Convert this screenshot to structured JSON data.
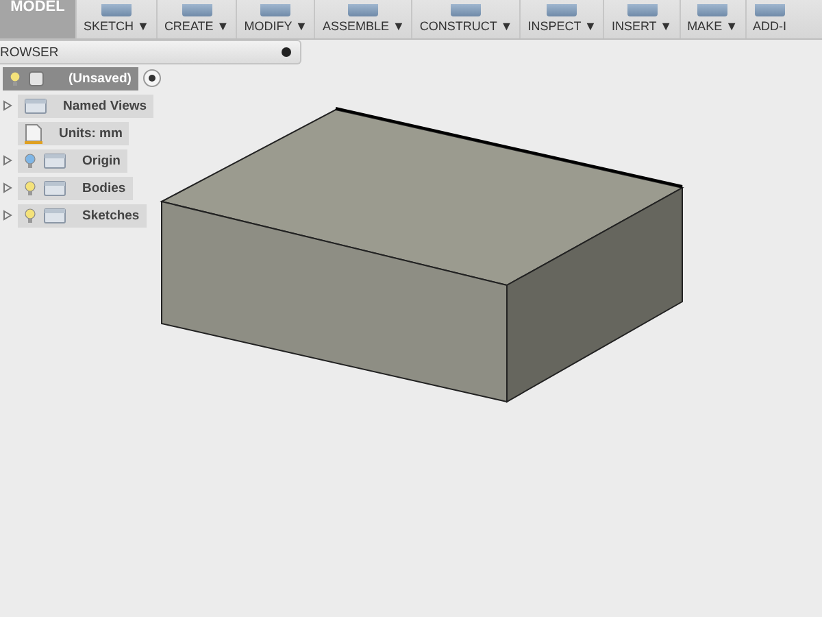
{
  "toolbar": {
    "workspace": "MODEL",
    "menus": [
      {
        "label": "SKETCH",
        "arrow": "▼"
      },
      {
        "label": "CREATE",
        "arrow": "▼"
      },
      {
        "label": "MODIFY",
        "arrow": "▼"
      },
      {
        "label": "ASSEMBLE",
        "arrow": "▼"
      },
      {
        "label": "CONSTRUCT",
        "arrow": "▼"
      },
      {
        "label": "INSPECT",
        "arrow": "▼"
      },
      {
        "label": "INSERT",
        "arrow": "▼"
      },
      {
        "label": "MAKE",
        "arrow": "▼"
      },
      {
        "label": "ADD-I"
      }
    ]
  },
  "browser": {
    "title": "ROWSER",
    "root": {
      "label": "(Unsaved)",
      "lit": true
    },
    "items": [
      {
        "label": "Named Views",
        "kind": "folder",
        "expanded": false
      },
      {
        "label": "Units: mm",
        "kind": "units"
      },
      {
        "label": "Origin",
        "kind": "folder",
        "expanded": false,
        "lit": false
      },
      {
        "label": "Bodies",
        "kind": "folder",
        "expanded": false,
        "lit": true
      },
      {
        "label": "Sketches",
        "kind": "folder",
        "expanded": false,
        "lit": true
      }
    ]
  }
}
